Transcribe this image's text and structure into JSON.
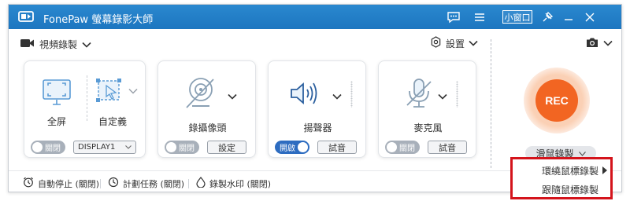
{
  "titlebar": {
    "app_name": "FonePaw 螢幕錄影大師",
    "mini_window_label": "小窗口",
    "icons": [
      "logo-icon",
      "chat-icon",
      "menu-icon",
      "pin-icon",
      "minimize-icon",
      "close-icon"
    ]
  },
  "toolbar": {
    "video_recording_label": "視頻錄製",
    "settings_label": "設置"
  },
  "cards": {
    "screen": {
      "fullscreen_label": "全屏",
      "custom_label": "自定義",
      "toggle_label": "關閉",
      "display_select": "DISPLAY1"
    },
    "webcam": {
      "label": "錄攝像頭",
      "toggle_label": "關閉",
      "settings_button": "設定"
    },
    "speaker": {
      "label": "揚聲器",
      "toggle_label": "開啟",
      "test_button": "試音"
    },
    "microphone": {
      "label": "麥克風",
      "toggle_label": "關閉",
      "test_button": "試音"
    }
  },
  "rec": {
    "button_label": "REC",
    "mouse_recording_label": "滑鼠錄製"
  },
  "bottom_bar": {
    "auto_stop": "自動停止 (關閉)",
    "scheduled_task": "計劃任務 (關閉)",
    "watermark": "錄製水印 (關閉)"
  },
  "mouse_menu": {
    "items": [
      "環繞鼠標錄製",
      "跟隨鼠標錄製"
    ]
  },
  "colors": {
    "titlebar": "#1f7ac4",
    "rec": "#f26522",
    "toggle_on": "#2d6cc0",
    "toggle_off": "#a8b0ba",
    "menu_highlight_border": "#d4141c"
  }
}
